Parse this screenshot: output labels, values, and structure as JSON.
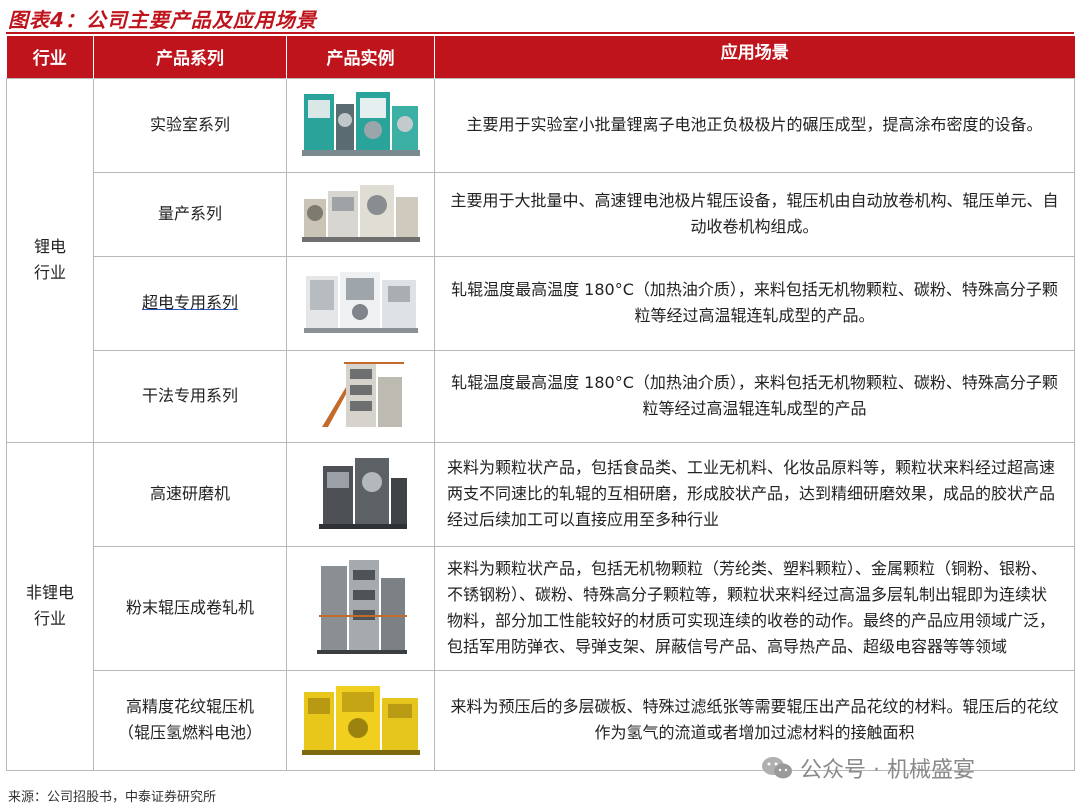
{
  "figure": {
    "title": "图表4：公司主要产品及应用场景"
  },
  "table": {
    "headers": [
      "行业",
      "产品系列",
      "产品实例",
      "应用场景"
    ],
    "groups": [
      {
        "industry": "锂电\n行业",
        "rows": [
          {
            "series": "实验室系列",
            "image": "lab-machine",
            "desc": "主要用于实验室小批量锂离子电池正负极极片的碾压成型，提高涂布密度的设备。"
          },
          {
            "series": "量产系列",
            "image": "mass-production-machine",
            "desc": "主要用于大批量中、高速锂电池极片辊压设备，辊压机由自动放卷机构、辊压单元、自动收卷机构组成。"
          },
          {
            "series": "超电专用系列",
            "image": "supercap-machine",
            "desc": "轧辊温度最高温度 180°C（加热油介质），来料包括无机物颗粒、碳粉、特殊高分子颗粒等经过高温辊连轧成型的产品。"
          },
          {
            "series": "干法专用系列",
            "image": "dry-process-machine",
            "desc": "轧辊温度最高温度 180°C（加热油介质），来料包括无机物颗粒、碳粉、特殊高分子颗粒等经过高温辊连轧成型的产品"
          }
        ]
      },
      {
        "industry": "非锂电\n行业",
        "rows": [
          {
            "series": "高速研磨机",
            "image": "grinder-machine",
            "desc": "来料为颗粒状产品，包括食品类、工业无机料、化妆品原料等，颗粒状来料经过超高速两支不同速比的轧辊的互相研磨，形成胶状产品，达到精细研磨效果，成品的胶状产品经过后续加工可以直接应用至多种行业"
          },
          {
            "series": "粉末辊压成卷轧机",
            "image": "powder-roll-machine",
            "desc": "来料为颗粒状产品，包括无机物颗粒（芳纶类、塑料颗粒）、金属颗粒（铜粉、银粉、不锈钢粉）、碳粉、特殊高分子颗粒等，颗粒状来料经过高温多层轧制出辊即为连续状物料，部分加工性能较好的材质可实现连续的收卷的动作。最终的产品应用领域广泛，包括军用防弹衣、导弹支架、屏蔽信号产品、高导热产品、超级电容器等等领域"
          },
          {
            "series": "高精度花纹辊压机\n（辊压氢燃料电池）",
            "image": "pattern-roll-machine",
            "desc": "来料为预压后的多层碳板、特殊过滤纸张等需要辊压出产品花纹的材料。辊压后的花纹作为氢气的流道或者增加过滤材料的接触面积"
          }
        ]
      }
    ]
  },
  "footer": {
    "source": "来源：公司招股书，中泰证券研究所"
  },
  "watermark": {
    "text": "公众号 · 机械盛宴",
    "icon": "wechat-icon"
  },
  "colors": {
    "accent": "#c0141c",
    "border": "#b8b8b8"
  }
}
